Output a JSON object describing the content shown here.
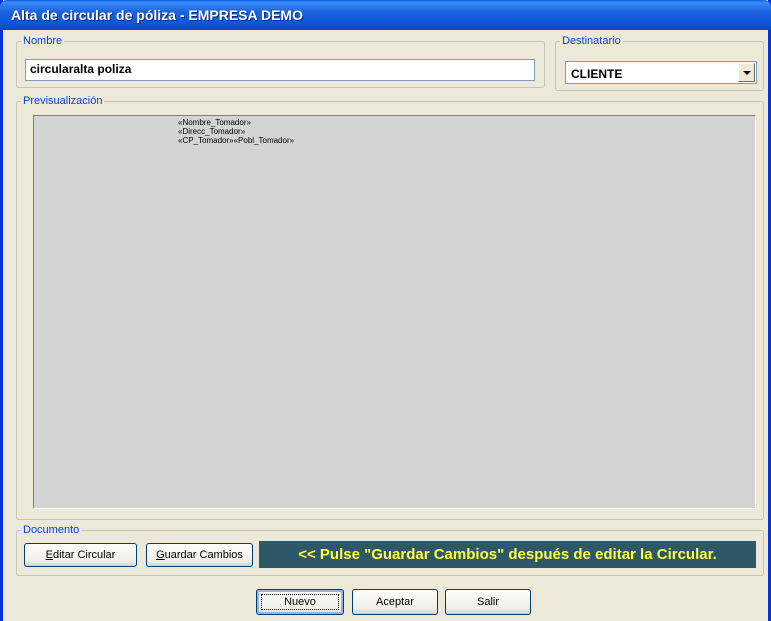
{
  "window": {
    "title": "Alta de circular de póliza - EMPRESA DEMO"
  },
  "nombre": {
    "legend": "Nombre",
    "value": "circularalta poliza"
  },
  "destinatario": {
    "legend": "Destinatario",
    "value": "CLIENTE"
  },
  "preview": {
    "legend": "Previsualización",
    "lines": [
      "«Nombre_Tomador»",
      "«Direcc_Tomador»",
      "«CP_Tomador»«Pobl_Tomador»"
    ]
  },
  "documento": {
    "legend": "Documento",
    "edit_mn": "E",
    "edit_rest": "ditar Circular",
    "save_mn": "G",
    "save_rest": "uardar Cambios",
    "hint": "<< Pulse \"Guardar Cambios\" después de editar la Circular."
  },
  "buttons": {
    "nuevo": "Nuevo",
    "aceptar": "Aceptar",
    "salir": "Salir"
  },
  "colors": {
    "titlebar": "#0a5ee0",
    "legend": "#0046d5",
    "hint_bg": "#2d5868",
    "hint_text": "#ffff40"
  }
}
